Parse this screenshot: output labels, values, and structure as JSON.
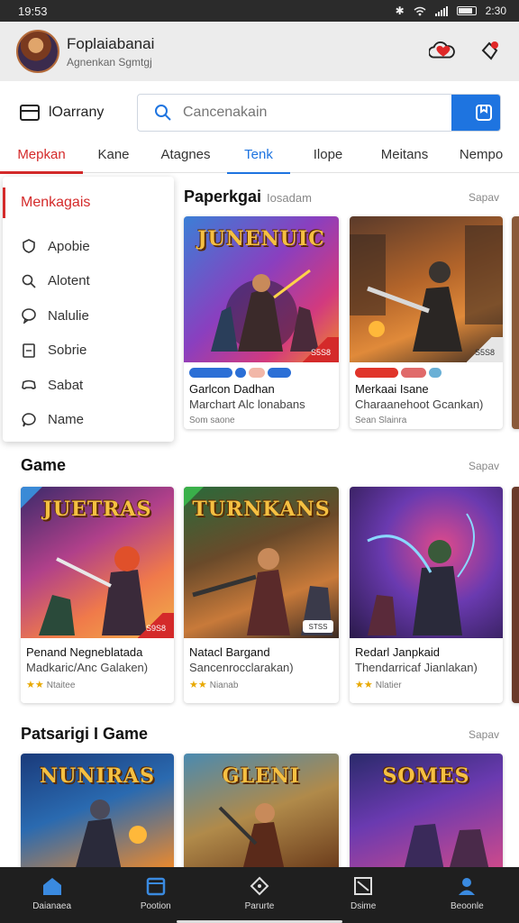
{
  "status_bar": {
    "time": "19:53",
    "right_text": "2:30"
  },
  "header": {
    "user_name": "Foplaiabanai",
    "user_sub": "Agnenkan Sgmtgj"
  },
  "search": {
    "category_label": "lOarrany",
    "placeholder": "Cancenakain"
  },
  "tabs": [
    {
      "label": "Mepkan"
    },
    {
      "label": "Kane"
    },
    {
      "label": "Atagnes"
    },
    {
      "label": "Tenk"
    },
    {
      "label": "Ilope"
    },
    {
      "label": "Meitans"
    },
    {
      "label": "Nempo"
    }
  ],
  "dropdown": {
    "title": "Menkagais",
    "items": [
      {
        "label": "Apobie",
        "icon": "shield-icon"
      },
      {
        "label": "Alotent",
        "icon": "search-icon"
      },
      {
        "label": "Nalulie",
        "icon": "chat-icon"
      },
      {
        "label": "Sobrie",
        "icon": "document-icon"
      },
      {
        "label": "Sabat",
        "icon": "controller-icon"
      },
      {
        "label": "Name",
        "icon": "chat-bubble-icon"
      }
    ]
  },
  "section1": {
    "title": "Paperkgai",
    "subtitle": "Iosadam",
    "see_more": "Sapav",
    "cards": [
      {
        "art_title": "JUNENUIC",
        "price": "S5S8",
        "title": "Garlcon Dadhan",
        "subtitle": "Marchart Alc lonabans",
        "meta": "Som saone"
      },
      {
        "art_title": "",
        "price": "S5S8",
        "title": "Merkaai Isane",
        "subtitle": "Charaanehoot Gcankan)",
        "meta": "Sean Slainra"
      }
    ]
  },
  "section2": {
    "title": "Game",
    "see_more": "Sapav",
    "cards": [
      {
        "art_title": "JUETRAS",
        "price": "S9S8",
        "title": "Penand Negneblatada",
        "subtitle": "Madkaric/Anc Galaken)",
        "meta": "Ntaitee"
      },
      {
        "art_title": "TURNKANS",
        "price": "STSS",
        "title": "Natacl Bargand",
        "subtitle": "Sancenrocclarakan)",
        "meta": "Nianab"
      },
      {
        "art_title": "",
        "price": "",
        "title": "Redarl Janpkaid",
        "subtitle": "Thendarricaf Jianlakan)",
        "meta": "Nlatier"
      }
    ]
  },
  "section3": {
    "title": "Patsarigi I Game",
    "see_more": "Sapav",
    "cards": [
      {
        "art_title": "NUNIRAS"
      },
      {
        "art_title": "GLENI"
      },
      {
        "art_title": "SOMES"
      }
    ]
  },
  "bottom_nav": [
    {
      "label": "Daianaea",
      "icon": "home-icon"
    },
    {
      "label": "Pootion",
      "icon": "library-icon"
    },
    {
      "label": "Parurte",
      "icon": "compass-icon"
    },
    {
      "label": "Dsime",
      "icon": "grid-icon"
    },
    {
      "label": "Beoonle",
      "icon": "profile-icon"
    }
  ],
  "colors": {
    "accent_red": "#d42a2a",
    "accent_blue": "#1e74e0",
    "nav_bg": "#1f1f1f"
  }
}
